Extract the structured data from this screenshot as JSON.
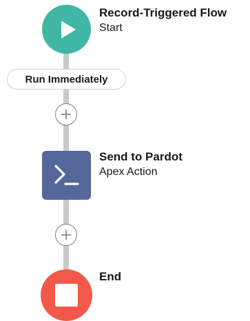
{
  "flow": {
    "start": {
      "title": "Record-Triggered Flow",
      "subtitle": "Start",
      "icon": "play-icon",
      "color": "#3fb7a2"
    },
    "run_label": "Run Immediately",
    "action": {
      "title": "Send to Pardot",
      "subtitle": "Apex Action",
      "icon": "terminal-prompt-icon",
      "color": "#56689a"
    },
    "end": {
      "title": "End",
      "icon": "stop-icon",
      "color": "#f2594b"
    },
    "add_element_icon": "add-circle-icon",
    "connector_color": "#c9c9c9"
  }
}
